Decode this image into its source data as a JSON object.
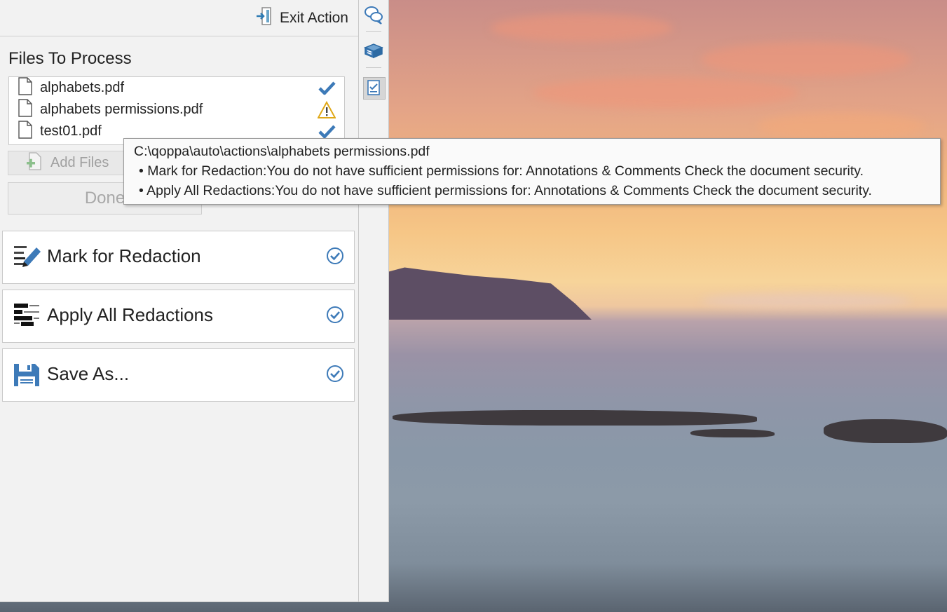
{
  "header": {
    "exit_label": "Exit Action",
    "exit_icon": "exit-door-icon"
  },
  "files_section": {
    "title": "Files To Process",
    "files": [
      {
        "name": "alphabets.pdf",
        "status": "success",
        "status_icon": "checkmark-icon"
      },
      {
        "name": "alphabets permissions.pdf",
        "status": "warning",
        "status_icon": "warning-triangle-icon"
      },
      {
        "name": "test01.pdf",
        "status": "success",
        "status_icon": "checkmark-icon"
      }
    ],
    "add_files_label": "Add Files",
    "done_label": "Done"
  },
  "actions": [
    {
      "label": "Mark for Redaction",
      "icon": "mark-redaction-icon",
      "completed": true
    },
    {
      "label": "Apply All Redactions",
      "icon": "apply-redactions-icon",
      "completed": true
    },
    {
      "label": "Save As...",
      "icon": "save-as-icon",
      "completed": true
    }
  ],
  "toolbar": {
    "buttons": [
      {
        "icon": "comments-icon"
      },
      {
        "icon": "stamps-icon"
      },
      {
        "icon": "checklist-icon",
        "active": true
      }
    ]
  },
  "tooltip": {
    "path": "C:\\qoppa\\auto\\actions\\alphabets permissions.pdf",
    "lines": [
      "• Mark for Redaction:You do not have sufficient permissions for: Annotations & Comments Check the document security.",
      "• Apply All Redactions:You do not have sufficient permissions for: Annotations & Comments Check the document security."
    ]
  },
  "colors": {
    "accent": "#3d7ab8",
    "warning": "#e0a818",
    "panel_bg": "#f2f2f2"
  }
}
